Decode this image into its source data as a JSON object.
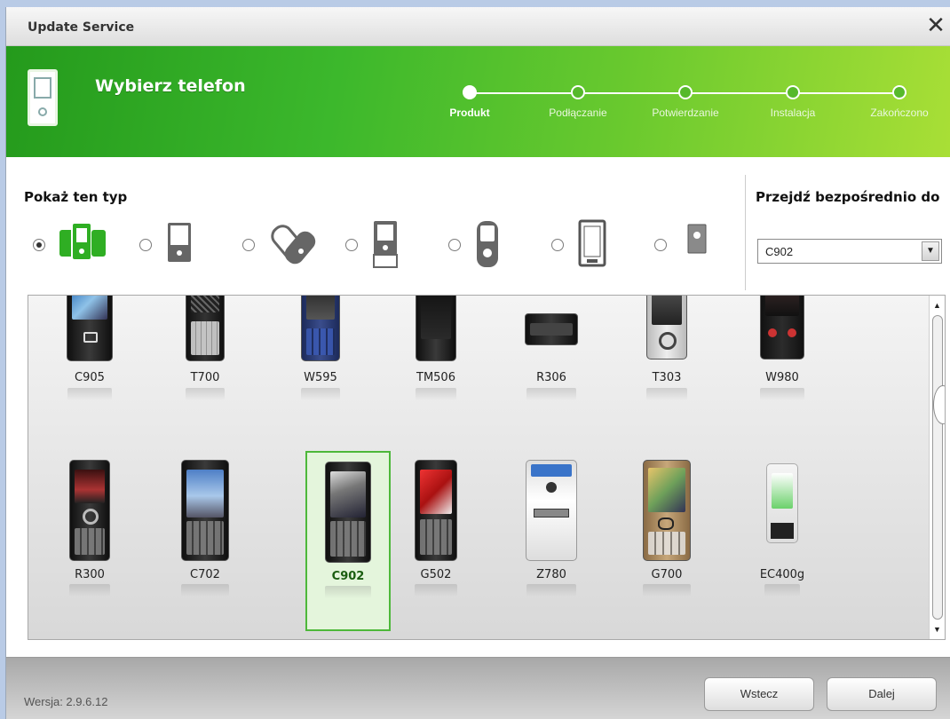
{
  "window": {
    "title": "Update Service",
    "close_glyph": "✕"
  },
  "header": {
    "heading": "Wybierz telefon",
    "steps": [
      {
        "label": "Produkt",
        "active": true
      },
      {
        "label": "Podłączanie",
        "active": false
      },
      {
        "label": "Potwierdzanie",
        "active": false
      },
      {
        "label": "Instalacja",
        "active": false
      },
      {
        "label": "Zakończono",
        "active": false
      }
    ]
  },
  "filter": {
    "title": "Pokaż ten typ",
    "types": [
      {
        "icon": "all-phones-icon",
        "selected": true
      },
      {
        "icon": "bar-phone-icon",
        "selected": false
      },
      {
        "icon": "accessory-icon",
        "selected": false
      },
      {
        "icon": "slider-phone-icon",
        "selected": false
      },
      {
        "icon": "walkman-phone-icon",
        "selected": false
      },
      {
        "icon": "touchscreen-phone-icon",
        "selected": false
      },
      {
        "icon": "other-device-icon",
        "selected": false
      }
    ]
  },
  "jump": {
    "title": "Przejdź bezpośrednio do",
    "selected": "C902",
    "arrow_glyph": "▼"
  },
  "phones": {
    "row1": [
      "C905",
      "T700",
      "W595",
      "TM506",
      "R306",
      "T303",
      "W980"
    ],
    "row2": [
      "R300",
      "C702",
      "C902",
      "G502",
      "Z780",
      "G700",
      "EC400g"
    ],
    "selected": "C902"
  },
  "scrollbar": {
    "up_glyph": "▲",
    "down_glyph": "▼"
  },
  "footer": {
    "version": "Wersja: 2.9.6.12",
    "back_label": "Wstecz",
    "next_label": "Dalej"
  },
  "colors": {
    "brand_green": "#3cb82c",
    "selection_green": "#4db83a"
  }
}
